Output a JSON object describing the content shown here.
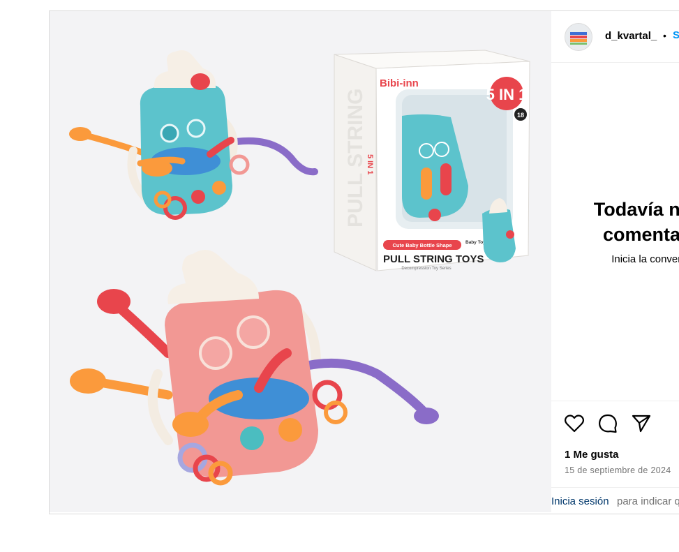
{
  "post": {
    "username": "d_kvartal_",
    "separator": "•",
    "follow_label": "Seguir",
    "empty_comments": {
      "title_line1": "Todavía no hay",
      "title_line2": "comentarios.",
      "subtitle": "Inicia la conversación."
    },
    "actions": {
      "like_icon": "heart-icon",
      "comment_icon": "comment-icon",
      "share_icon": "paper-plane-icon"
    },
    "likes_text": "1 Me gusta",
    "date_text": "15 de septiembre de 2024",
    "login_prompt": {
      "link_label": "Inicia sesión",
      "rest_text": "para indicar que te gusta o comentar."
    }
  },
  "media": {
    "box_brand": "Bibi-inn",
    "box_badge": "5 IN 1",
    "box_age": "18",
    "box_side_text": "PULL STRING",
    "box_side_badge": "5 IN 1",
    "box_ribbon": "Cute Baby Bottle Shape",
    "box_series": "Baby Toy Series",
    "box_title": "PULL STRING TOYS",
    "box_subtitle": "Decompression Toy Series",
    "colors": {
      "blue_toy": "#5cc3cc",
      "pink_toy": "#f29894",
      "cap": "#f6efe6",
      "orange": "#fb9a3c",
      "purple": "#8a6cc8",
      "red": "#e8454c"
    }
  }
}
